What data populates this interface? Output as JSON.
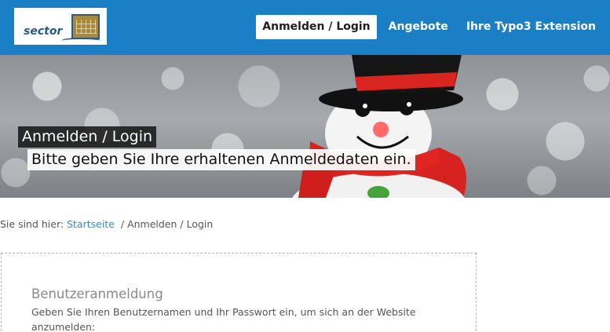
{
  "header": {
    "logo_text": "sector",
    "nav": [
      {
        "label": "Anmelden / Login",
        "active": true
      },
      {
        "label": "Angebote",
        "active": false
      },
      {
        "label": "Ihre Typo3 Extension",
        "active": false
      }
    ]
  },
  "hero": {
    "title": "Anmelden / Login",
    "subtitle": "Bitte geben Sie Ihre erhaltenen Anmeldedaten ein."
  },
  "breadcrumb": {
    "prefix": "Sie sind hier:",
    "home": "Startseite",
    "separator": "/",
    "current": "Anmelden / Login"
  },
  "login": {
    "title": "Benutzeranmeldung",
    "instructions": "Geben Sie Ihren Benutzernamen und Ihr Passwort ein, um sich an der Website anzumelden:"
  },
  "colors": {
    "header_bg": "#1a7fc4",
    "link": "#2c8fd6"
  }
}
